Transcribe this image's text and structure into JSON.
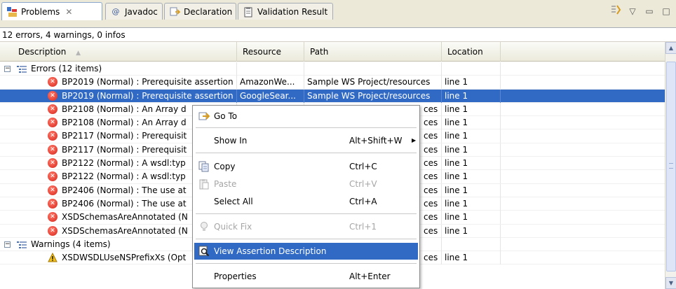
{
  "tabs": [
    {
      "label": "Problems",
      "icon": "problems-icon",
      "active": true,
      "closable": true
    },
    {
      "label": "Javadoc",
      "icon": "at-icon"
    },
    {
      "label": "Declaration",
      "icon": "declaration-icon"
    },
    {
      "label": "Validation Result",
      "icon": "clipboard-icon"
    }
  ],
  "summary": "12 errors, 4 warnings, 0 infos",
  "columns": {
    "description": "Description",
    "resource": "Resource",
    "path": "Path",
    "location": "Location"
  },
  "groups": {
    "errors": "Errors (12 items)",
    "warnings": "Warnings (4 items)"
  },
  "rows": [
    {
      "desc": "BP2019 (Normal) : Prerequisite assertion",
      "resource": "AmazonWe...",
      "path": "Sample WS Project/resources",
      "loc": "line 1"
    },
    {
      "desc": "BP2019 (Normal) : Prerequisite assertion",
      "resource": "GoogleSear...",
      "path": "Sample WS Project/resources",
      "loc": "line 1"
    },
    {
      "desc": "BP2108 (Normal) : An Array d",
      "path": "ces",
      "loc": "line 1"
    },
    {
      "desc": "BP2108 (Normal) : An Array d",
      "path": "ces",
      "loc": "line 1"
    },
    {
      "desc": "BP2117 (Normal) : Prerequisit",
      "path": "ces",
      "loc": "line 1"
    },
    {
      "desc": "BP2117 (Normal) : Prerequisit",
      "path": "ces",
      "loc": "line 1"
    },
    {
      "desc": "BP2122 (Normal) : A wsdl:typ",
      "path": "ces",
      "loc": "line 1"
    },
    {
      "desc": "BP2122 (Normal) : A wsdl:typ",
      "path": "ces",
      "loc": "line 1"
    },
    {
      "desc": "BP2406 (Normal) : The use at",
      "path": "ces",
      "loc": "line 1"
    },
    {
      "desc": "BP2406 (Normal) : The use at",
      "path": "ces",
      "loc": "line 1"
    },
    {
      "desc": "XSDSchemasAreAnnotated (N",
      "path": "ces",
      "loc": "line 1"
    },
    {
      "desc": "XSDSchemasAreAnnotated (N",
      "path": "ces",
      "loc": "line 1"
    }
  ],
  "warning_rows": [
    {
      "desc": "XSDWSDLUseNSPrefixXs (Opt",
      "path": "ces",
      "loc": "line 1"
    }
  ],
  "context_menu": {
    "go_to": "Go To",
    "show_in": "Show In",
    "show_in_accel": "Alt+Shift+W",
    "copy": "Copy",
    "copy_accel": "Ctrl+C",
    "paste": "Paste",
    "paste_accel": "Ctrl+V",
    "select_all": "Select All",
    "select_all_accel": "Ctrl+A",
    "quick_fix": "Quick Fix",
    "quick_fix_accel": "Ctrl+1",
    "view_assertion": "View Assertion Description",
    "properties": "Properties",
    "properties_accel": "Alt+Enter"
  },
  "colors": {
    "selection": "#316ac5",
    "error": "#d8241a",
    "warning": "#f0c020"
  }
}
